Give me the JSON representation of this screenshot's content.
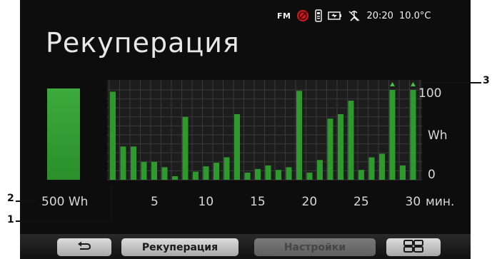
{
  "status": {
    "radio": "FM",
    "time": "20:20",
    "temperature": "10.0°C"
  },
  "title": "Рекуперация",
  "stored_energy": {
    "label": "500 Wh",
    "level_fraction": 1.0
  },
  "callouts": [
    "1",
    "2",
    "3"
  ],
  "chart_data": {
    "type": "bar",
    "title": "",
    "xlabel": "мин.",
    "ylabel": "Wh",
    "ylim": [
      0,
      100
    ],
    "xticks": [
      "5",
      "10",
      "15",
      "20",
      "25",
      "30"
    ],
    "yticks": [
      "100",
      "Wh",
      "0"
    ],
    "x": [
      1,
      2,
      3,
      4,
      5,
      6,
      7,
      8,
      9,
      10,
      11,
      12,
      13,
      14,
      15,
      16,
      17,
      18,
      19,
      20,
      21,
      22,
      23,
      24,
      25,
      26,
      27,
      28,
      29,
      30
    ],
    "values": [
      98,
      37,
      37,
      20,
      20,
      14,
      4,
      70,
      9,
      15,
      19,
      25,
      73,
      8,
      12,
      16,
      11,
      14,
      99,
      8,
      22,
      68,
      73,
      88,
      11,
      25,
      29,
      100,
      16,
      100
    ],
    "overflow": [
      28,
      30
    ],
    "color": "#2e9a2e"
  },
  "bottom_bar": {
    "back_icon": "back-arrow-icon",
    "tab_recuperation": "Рекуперация",
    "tab_settings": "Настройки",
    "menu_icon": "grid-menu-icon"
  }
}
